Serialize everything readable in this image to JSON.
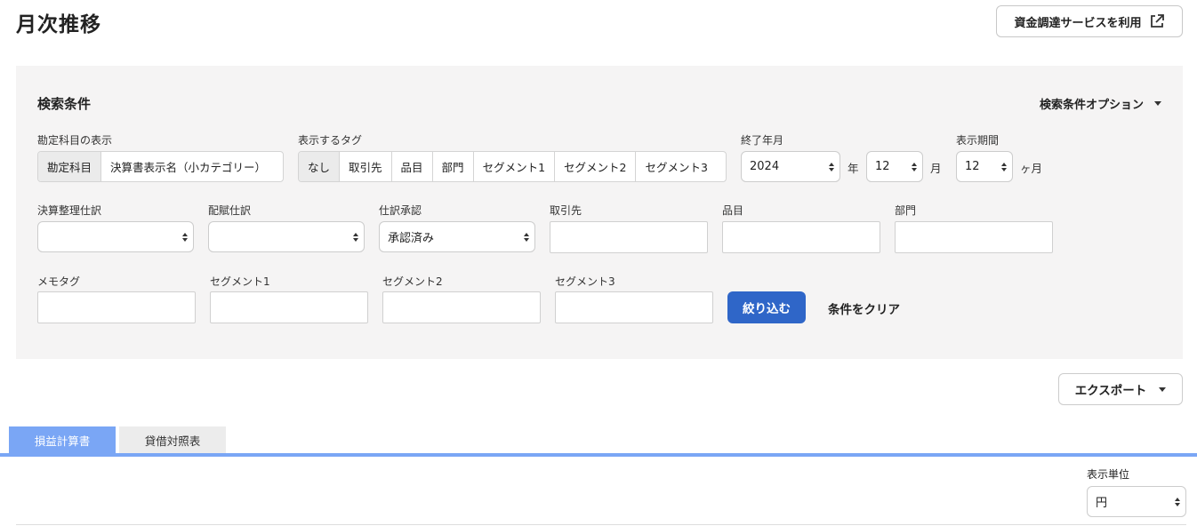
{
  "page": {
    "title": "月次推移"
  },
  "funding": {
    "label": "資金調達サービスを利用",
    "icon": "external-link-icon"
  },
  "search": {
    "title": "検索条件",
    "options_label": "検索条件オプション",
    "account_display": {
      "label": "勘定科目の表示",
      "options": [
        "勘定科目",
        "決算書表示名（小カテゴリー）"
      ],
      "selected": "勘定科目"
    },
    "tags": {
      "label": "表示するタグ",
      "options": [
        "なし",
        "取引先",
        "品目",
        "部門",
        "セグメント1",
        "セグメント2",
        "セグメント3"
      ],
      "selected": "なし"
    },
    "end_month": {
      "label": "終了年月",
      "year": "2024",
      "year_unit": "年",
      "month": "12",
      "month_unit": "月"
    },
    "period": {
      "label": "表示期間",
      "value": "12",
      "unit": "ヶ月"
    },
    "closing_entries": {
      "label": "決算整理仕訳",
      "value": ""
    },
    "allocation_entries": {
      "label": "配賦仕訳",
      "value": ""
    },
    "approval": {
      "label": "仕訳承認",
      "value": "承認済み"
    },
    "partner": {
      "label": "取引先",
      "value": ""
    },
    "item": {
      "label": "品目",
      "value": ""
    },
    "department": {
      "label": "部門",
      "value": ""
    },
    "memo_tag": {
      "label": "メモタグ",
      "value": ""
    },
    "segment1": {
      "label": "セグメント1",
      "value": ""
    },
    "segment2": {
      "label": "セグメント2",
      "value": ""
    },
    "segment3": {
      "label": "セグメント3",
      "value": ""
    },
    "filter_button": "絞り込む",
    "clear_button": "条件をクリア"
  },
  "export": {
    "label": "エクスポート"
  },
  "tabs": [
    {
      "label": "損益計算書",
      "active": true
    },
    {
      "label": "貸借対照表",
      "active": false
    }
  ],
  "display_unit": {
    "label": "表示単位",
    "value": "円"
  },
  "colors": {
    "primary": "#2f66c8",
    "tab_active": "#7aa6f5",
    "panel_bg": "#f5f4f4"
  }
}
